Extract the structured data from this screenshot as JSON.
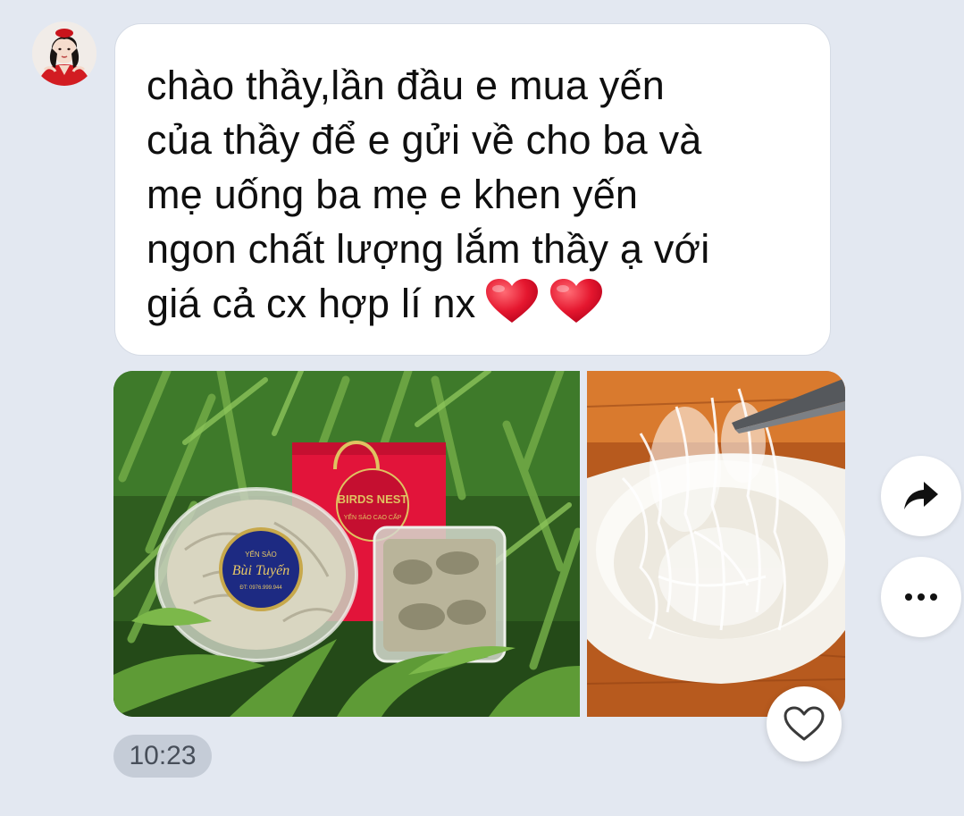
{
  "message": {
    "text": "chào thầy,lần đầu e mua yến\ncủa thầy để e gửi về cho ba và\nmẹ uống ba mẹ e khen yến\nngon chất lượng lắm thầy ạ với\ngiá cả cx hợp lí nx",
    "timestamp": "10:23",
    "emoji": [
      "heart-emoji",
      "heart-emoji"
    ]
  },
  "photos": [
    {
      "label_seal": "Bùi Tuyến",
      "label_seal_top": "YẾN SÀO",
      "label_seal_bottom": "ĐT: 0976.999.944",
      "label_bag": "BIRDS NEST",
      "label_bag_sub": "YẾN SÀO CAO CẤP"
    },
    {}
  ],
  "colors": {
    "background": "#e3e8f1",
    "bubble": "#ffffff",
    "heart_red": "#e5172f",
    "timestamp_pill": "#c5ccd7"
  },
  "icons": {
    "share": "share-arrow-icon",
    "more": "more-dots-icon",
    "react": "heart-outline-icon"
  }
}
